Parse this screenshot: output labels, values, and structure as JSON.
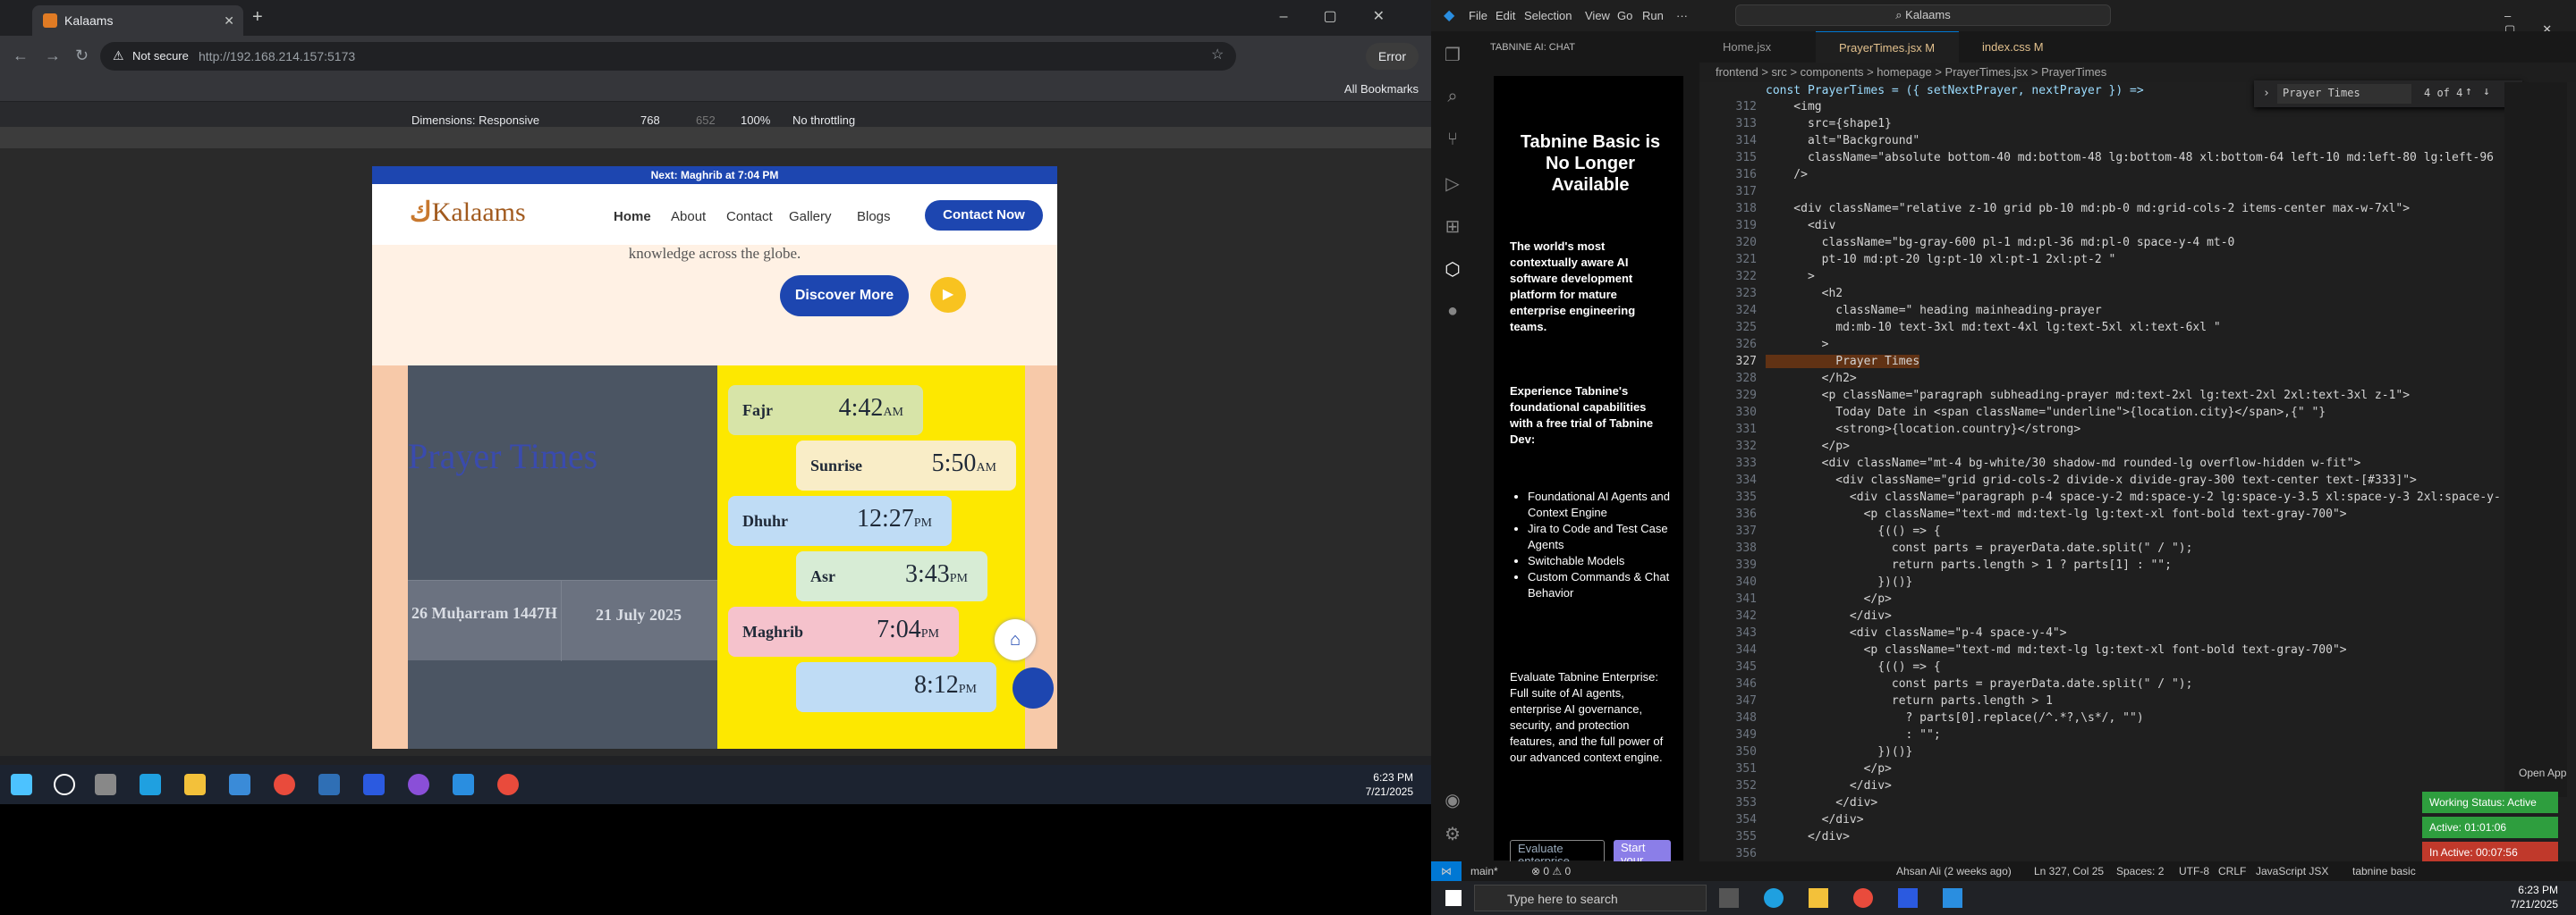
{
  "browser": {
    "tab_title": "Kalaams",
    "not_secure": "Not secure",
    "url": "http://192.168.214.157:5173",
    "error_label": "Error",
    "all_bookmarks": "All Bookmarks",
    "devtools": {
      "dimensions_label": "Dimensions: Responsive",
      "width": "768",
      "height": "652",
      "zoom": "100%",
      "throttle": "No throttling"
    }
  },
  "site": {
    "announcement": "Next: Maghrib at 7:04 PM",
    "logo": "Kalaams",
    "nav": [
      "Home",
      "About",
      "Contact",
      "Gallery",
      "Blogs"
    ],
    "cta": "Contact Now",
    "hero_tail": "knowledge across the globe.",
    "discover": "Discover More",
    "prayer_title": "Prayer Times",
    "hijri_date": "26 Muḥarram 1447H",
    "greg_date": "21 July 2025",
    "prayers": [
      {
        "name": "Fajr",
        "time": "4:42",
        "ampm": "AM"
      },
      {
        "name": "Sunrise",
        "time": "5:50",
        "ampm": "AM"
      },
      {
        "name": "Dhuhr",
        "time": "12:27",
        "ampm": "PM"
      },
      {
        "name": "Asr",
        "time": "3:43",
        "ampm": "PM"
      },
      {
        "name": "Maghrib",
        "time": "7:04",
        "ampm": "PM"
      },
      {
        "name": "",
        "time": "8:12",
        "ampm": "PM"
      }
    ]
  },
  "left_taskbar": {
    "time": "6:23 PM",
    "date": "7/21/2025"
  },
  "vscode": {
    "menu": [
      "File",
      "Edit",
      "Selection",
      "View",
      "Go",
      "Run",
      "···"
    ],
    "command_center": "Kalaams",
    "chat_header": "TABNINE AI: CHAT",
    "chat": {
      "title": "Tabnine Basic is No Longer Available",
      "p1": "The world's most contextually aware AI software development platform for mature enterprise engineering teams.",
      "p2": "Experience Tabnine's foundational capabilities with a free trial of Tabnine Dev:",
      "bullets": [
        "Foundational AI Agents and Context Engine",
        "Jira to Code and Test Case Agents",
        "Switchable Models",
        "Custom Commands & Chat Behavior"
      ],
      "p3": "Evaluate Tabnine Enterprise: Full suite of AI agents, enterprise AI governance, security, and protection features, and the full power of our advanced context engine.",
      "btn1": "Evaluate enterprise",
      "btn2": "Start your Dev trial"
    },
    "tabs": [
      {
        "label": "Home.jsx"
      },
      {
        "label": "PrayerTimes.jsx M"
      },
      {
        "label": "index.css M"
      }
    ],
    "breadcrumbs": "frontend > src > components > homepage > PrayerTimes.jsx > PrayerTimes",
    "find": {
      "query": "Prayer Times",
      "count": "4 of 4"
    },
    "sticky": "const PrayerTimes = ({ setNextPrayer, nextPrayer }) =>",
    "code": [
      {
        "n": "312",
        "t": "    <img"
      },
      {
        "n": "313",
        "t": "      src={shape1}"
      },
      {
        "n": "314",
        "t": "      alt=\"Background\""
      },
      {
        "n": "315",
        "t": "      className=\"absolute bottom-40 md:bottom-48 lg:bottom-48 xl:bottom-64 left-10 md:left-80 lg:left-96"
      },
      {
        "n": "316",
        "t": "    />"
      },
      {
        "n": "317",
        "t": ""
      },
      {
        "n": "318",
        "t": "    <div className=\"relative z-10 grid pb-10 md:pb-0 md:grid-cols-2 items-center max-w-7xl\">"
      },
      {
        "n": "319",
        "t": "      <div"
      },
      {
        "n": "320",
        "t": "        className=\"bg-gray-600 pl-1 md:pl-36 md:pl-0 space-y-4 mt-0"
      },
      {
        "n": "321",
        "t": "        pt-10 md:pt-20 lg:pt-10 xl:pt-1 2xl:pt-2 \""
      },
      {
        "n": "322",
        "t": "      >"
      },
      {
        "n": "323",
        "t": "        <h2"
      },
      {
        "n": "324",
        "t": "          className=\" heading mainheading-prayer"
      },
      {
        "n": "325",
        "t": "          md:mb-10 text-3xl md:text-4xl lg:text-5xl xl:text-6xl \""
      },
      {
        "n": "326",
        "t": "        >"
      },
      {
        "n": "327",
        "t": "          Prayer Times"
      },
      {
        "n": "328",
        "t": "        </h2>"
      },
      {
        "n": "329",
        "t": "        <p className=\"paragraph subheading-prayer md:text-2xl lg:text-2xl 2xl:text-3xl z-1\">"
      },
      {
        "n": "330",
        "t": "          Today Date in <span className=\"underline\">{location.city}</span>,{\" \"}"
      },
      {
        "n": "331",
        "t": "          <strong>{location.country}</strong>"
      },
      {
        "n": "332",
        "t": "        </p>"
      },
      {
        "n": "333",
        "t": "        <div className=\"mt-4 bg-white/30 shadow-md rounded-lg overflow-hidden w-fit\">"
      },
      {
        "n": "334",
        "t": "          <div className=\"grid grid-cols-2 divide-x divide-gray-300 text-center text-[#333]\">"
      },
      {
        "n": "335",
        "t": "            <div className=\"paragraph p-4 space-y-2 md:space-y-2 lg:space-y-3.5 xl:space-y-3 2xl:space-y-"
      },
      {
        "n": "336",
        "t": "              <p className=\"text-md md:text-lg lg:text-xl font-bold text-gray-700\">"
      },
      {
        "n": "337",
        "t": "                {(() => {"
      },
      {
        "n": "338",
        "t": "                  const parts = prayerData.date.split(\" / \");"
      },
      {
        "n": "339",
        "t": "                  return parts.length > 1 ? parts[1] : \"\";"
      },
      {
        "n": "340",
        "t": "                })()}"
      },
      {
        "n": "341",
        "t": "              </p>"
      },
      {
        "n": "342",
        "t": "            </div>"
      },
      {
        "n": "343",
        "t": "            <div className=\"p-4 space-y-4\">"
      },
      {
        "n": "344",
        "t": "              <p className=\"text-md md:text-lg lg:text-xl font-bold text-gray-700\">"
      },
      {
        "n": "345",
        "t": "                {(() => {"
      },
      {
        "n": "346",
        "t": "                  const parts = prayerData.date.split(\" / \");"
      },
      {
        "n": "347",
        "t": "                  return parts.length > 1"
      },
      {
        "n": "348",
        "t": "                    ? parts[0].replace(/^.*?,\\s*/, \"\")"
      },
      {
        "n": "349",
        "t": "                    : \"\";"
      },
      {
        "n": "350",
        "t": "                })()}"
      },
      {
        "n": "351",
        "t": "              </p>"
      },
      {
        "n": "352",
        "t": "            </div>"
      },
      {
        "n": "353",
        "t": "          </div>"
      },
      {
        "n": "354",
        "t": "        </div>"
      },
      {
        "n": "355",
        "t": "      </div>"
      },
      {
        "n": "356",
        "t": ""
      }
    ],
    "open_app": "Open App",
    "status": {
      "branch": "main*",
      "problems": "⊗ 0 ⚠ 0",
      "blame": "Ahsan Ali (2 weeks ago)",
      "pos": "Ln 327, Col 25",
      "spaces": "Spaces: 2",
      "enc": "UTF-8",
      "eol": "CRLF",
      "lang": "JavaScript JSX",
      "tabnine": "tabnine basic"
    },
    "toasts": {
      "working": "Working Status: Active",
      "active": "Active: 01:01:06",
      "inactive": "In Active: 00:07:56"
    },
    "taskbar": {
      "search": "Type here to search",
      "time": "6:23 PM",
      "date": "7/21/2025"
    }
  }
}
